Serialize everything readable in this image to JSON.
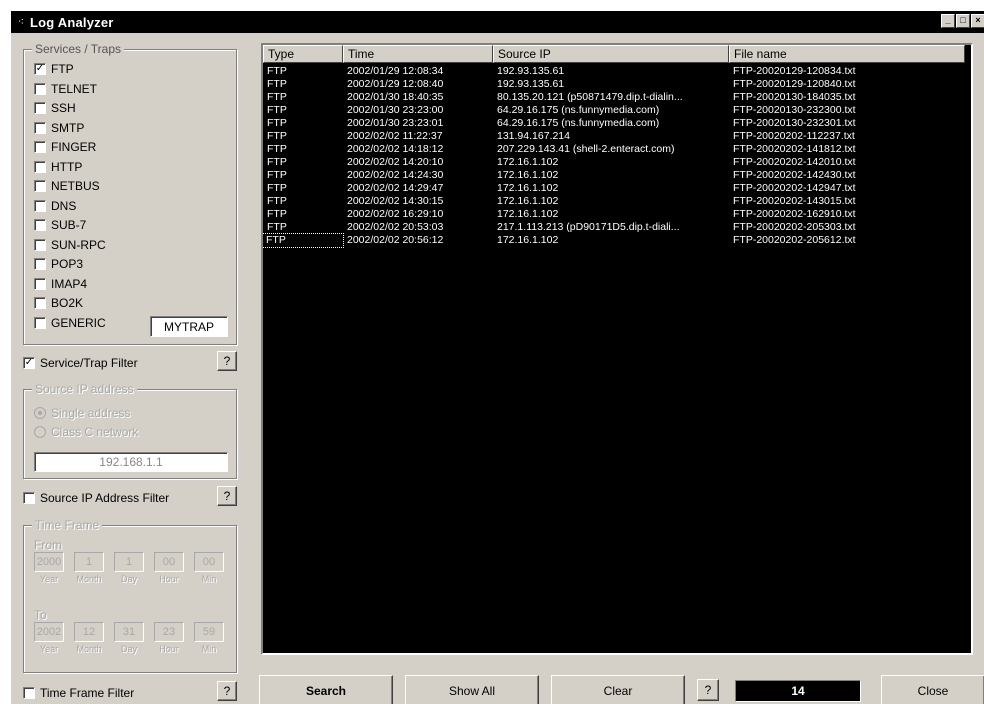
{
  "window": {
    "title": "Log Analyzer"
  },
  "services": {
    "group_label": "Services / Traps",
    "items": [
      {
        "label": "FTP",
        "checked": true
      },
      {
        "label": "TELNET",
        "checked": false
      },
      {
        "label": "SSH",
        "checked": false
      },
      {
        "label": "SMTP",
        "checked": false
      },
      {
        "label": "FINGER",
        "checked": false
      },
      {
        "label": "HTTP",
        "checked": false
      },
      {
        "label": "NETBUS",
        "checked": false
      },
      {
        "label": "DNS",
        "checked": false
      },
      {
        "label": "SUB-7",
        "checked": false
      },
      {
        "label": "SUN-RPC",
        "checked": false
      },
      {
        "label": "POP3",
        "checked": false
      },
      {
        "label": "IMAP4",
        "checked": false
      },
      {
        "label": "BO2K",
        "checked": false
      },
      {
        "label": "GENERIC",
        "checked": false
      }
    ],
    "generic_value": "MYTRAP"
  },
  "service_filter": {
    "label": "Service/Trap Filter",
    "checked": true,
    "help": "?"
  },
  "source_ip": {
    "group_label": "Source IP address",
    "single_label": "Single address",
    "class_label": "Class C network",
    "value": "192.168.1.1"
  },
  "source_ip_filter": {
    "label": "Source IP Address Filter",
    "checked": false,
    "help": "?"
  },
  "time_frame": {
    "group_label": "Time Frame",
    "from_label": "From",
    "to_label": "To",
    "from": [
      "2000",
      "1",
      "1",
      "00",
      "00"
    ],
    "to": [
      "2002",
      "12",
      "31",
      "23",
      "59"
    ],
    "captions": [
      "Year",
      "Month",
      "Day",
      "Hour",
      "Min"
    ]
  },
  "time_frame_filter": {
    "label": "Time Frame Filter",
    "checked": false,
    "help": "?"
  },
  "table": {
    "columns": [
      "Type",
      "Time",
      "Source IP",
      "File name"
    ],
    "rows": [
      [
        "FTP",
        "2002/01/29 12:08:34",
        "192.93.135.61",
        "FTP-20020129-120834.txt"
      ],
      [
        "FTP",
        "2002/01/29 12:08:40",
        "192.93.135.61",
        "FTP-20020129-120840.txt"
      ],
      [
        "FTP",
        "2002/01/30 18:40:35",
        "80.135.20.121  (p50871479.dip.t-dialin...",
        "FTP-20020130-184035.txt"
      ],
      [
        "FTP",
        "2002/01/30 23:23:00",
        "64.29.16.175  (ns.funnymedia.com)",
        "FTP-20020130-232300.txt"
      ],
      [
        "FTP",
        "2002/01/30 23:23:01",
        "64.29.16.175  (ns.funnymedia.com)",
        "FTP-20020130-232301.txt"
      ],
      [
        "FTP",
        "2002/02/02 11:22:37",
        "131.94.167.214",
        "FTP-20020202-112237.txt"
      ],
      [
        "FTP",
        "2002/02/02 14:18:12",
        "207.229.143.41  (shell-2.enteract.com)",
        "FTP-20020202-141812.txt"
      ],
      [
        "FTP",
        "2002/02/02 14:20:10",
        "172.16.1.102",
        "FTP-20020202-142010.txt"
      ],
      [
        "FTP",
        "2002/02/02 14:24:30",
        "172.16.1.102",
        "FTP-20020202-142430.txt"
      ],
      [
        "FTP",
        "2002/02/02 14:29:47",
        "172.16.1.102",
        "FTP-20020202-142947.txt"
      ],
      [
        "FTP",
        "2002/02/02 14:30:15",
        "172.16.1.102",
        "FTP-20020202-143015.txt"
      ],
      [
        "FTP",
        "2002/02/02 16:29:10",
        "172.16.1.102",
        "FTP-20020202-162910.txt"
      ],
      [
        "FTP",
        "2002/02/02 20:53:03",
        "217.1.113.213  (pD90171D5.dip.t-diali...",
        "FTP-20020202-205303.txt"
      ],
      [
        "FTP",
        "2002/02/02 20:56:12",
        "172.16.1.102",
        "FTP-20020202-205612.txt"
      ]
    ]
  },
  "buttons": {
    "search": "Search",
    "show_all": "Show All",
    "clear": "Clear",
    "help": "?",
    "close": "Close"
  },
  "result_count": "14",
  "titlebar_buttons": [
    "_",
    "□",
    "×"
  ]
}
